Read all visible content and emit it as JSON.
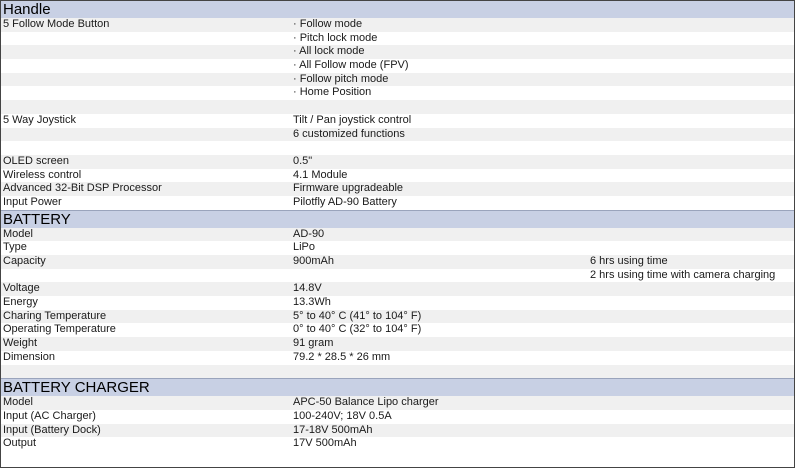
{
  "sections": [
    {
      "title": "Handle",
      "rows": [
        {
          "label": "5 Follow Mode Button",
          "value": "· Follow mode",
          "note": ""
        },
        {
          "label": "",
          "value": "· Pitch lock mode",
          "note": ""
        },
        {
          "label": "",
          "value": "· All lock mode",
          "note": ""
        },
        {
          "label": "",
          "value": "· All Follow mode (FPV)",
          "note": ""
        },
        {
          "label": "",
          "value": "· Follow pitch mode",
          "note": ""
        },
        {
          "label": "",
          "value": "· Home Position",
          "note": ""
        },
        {
          "label": "",
          "value": "",
          "note": ""
        },
        {
          "label": "5 Way Joystick",
          "value": "Tilt / Pan joystick control",
          "note": ""
        },
        {
          "label": "",
          "value": "6 customized functions",
          "note": ""
        },
        {
          "label": "",
          "value": "",
          "note": ""
        },
        {
          "label": "OLED screen",
          "value": "0.5\"",
          "note": ""
        },
        {
          "label": "Wireless control",
          "value": "4.1 Module",
          "note": ""
        },
        {
          "label": "Advanced 32-Bit DSP Processor",
          "value": "Firmware upgradeable",
          "note": ""
        },
        {
          "label": "Input Power",
          "value": "Pilotfly AD-90 Battery",
          "note": ""
        }
      ]
    },
    {
      "title": "BATTERY",
      "rows": [
        {
          "label": "Model",
          "value": "AD-90",
          "note": ""
        },
        {
          "label": "Type",
          "value": "LiPo",
          "note": ""
        },
        {
          "label": "Capacity",
          "value": "900mAh",
          "note": "6 hrs using time"
        },
        {
          "label": "",
          "value": "",
          "note": "2 hrs using time with camera charging"
        },
        {
          "label": "Voltage",
          "value": "14.8V",
          "note": ""
        },
        {
          "label": "Energy",
          "value": "13.3Wh",
          "note": ""
        },
        {
          "label": "Charing Temperature",
          "value": "5° to 40° C (41° to 104° F)",
          "note": ""
        },
        {
          "label": "Operating Temperature",
          "value": "0° to 40° C (32° to 104° F)",
          "note": ""
        },
        {
          "label": "Weight",
          "value": "91 gram",
          "note": ""
        },
        {
          "label": "Dimension",
          "value": "79.2 * 28.5 * 26 mm",
          "note": ""
        },
        {
          "label": "",
          "value": "",
          "note": ""
        }
      ]
    },
    {
      "title": "BATTERY CHARGER",
      "rows": [
        {
          "label": "Model",
          "value": "APC-50 Balance Lipo charger",
          "note": ""
        },
        {
          "label": "Input (AC Charger)",
          "value": "100-240V; 18V 0.5A",
          "note": ""
        },
        {
          "label": "Input (Battery Dock)",
          "value": "17-18V 500mAh",
          "note": ""
        },
        {
          "label": "Output",
          "value": "17V 500mAh",
          "note": ""
        }
      ]
    }
  ]
}
